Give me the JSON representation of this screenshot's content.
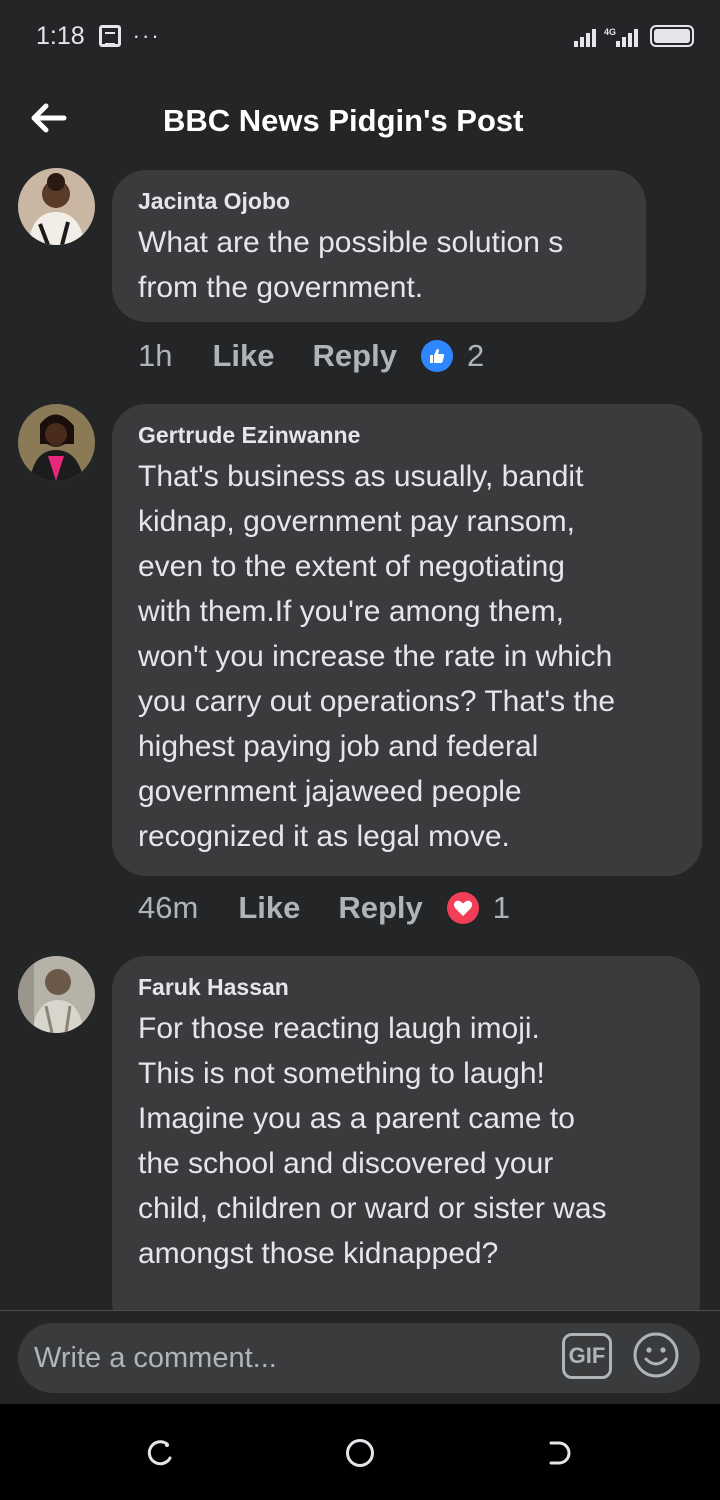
{
  "status_bar": {
    "time": "1:18",
    "more": "···",
    "network": "4G"
  },
  "header": {
    "title": "BBC News Pidgin's Post"
  },
  "comments": [
    {
      "author": "Jacinta Ojobo",
      "lines": [
        "What are the possible solution s",
        "from the government."
      ],
      "time": "1h",
      "like_label": "Like",
      "reply_label": "Reply",
      "reaction": "like",
      "reaction_count": "2"
    },
    {
      "author": "Gertrude Ezinwanne",
      "lines": [
        "That's business as usually, bandit",
        "kidnap, government pay ransom,",
        "even to the extent of negotiating",
        "with them.If you're among them,",
        "won't you increase the rate in which",
        "you carry out operations? That's the",
        "highest paying job and federal",
        "government jajaweed people",
        "recognized it as legal move."
      ],
      "time": "46m",
      "like_label": "Like",
      "reply_label": "Reply",
      "reaction": "love",
      "reaction_count": "1"
    },
    {
      "author": "Faruk Hassan",
      "lines": [
        "For those reacting laugh imoji.",
        "This is not something to laugh!",
        "Imagine you as a parent came to",
        "the school and discovered your",
        "child, children or ward or sister was",
        "amongst those kidnapped?"
      ]
    }
  ],
  "composer": {
    "placeholder": "Write a comment...",
    "gif_label": "GIF"
  },
  "colors": {
    "background": "#242526",
    "bubble": "#3a3b3c",
    "text": "#e4e6eb",
    "secondary_text": "#b0b3b8",
    "like_blue": "#2d88ff",
    "love_red": "#f33e58"
  },
  "icons": [
    "back-arrow-icon",
    "like-reaction-icon",
    "love-reaction-icon",
    "emoji-icon",
    "recent-apps-icon",
    "home-icon",
    "back-nav-icon"
  ]
}
